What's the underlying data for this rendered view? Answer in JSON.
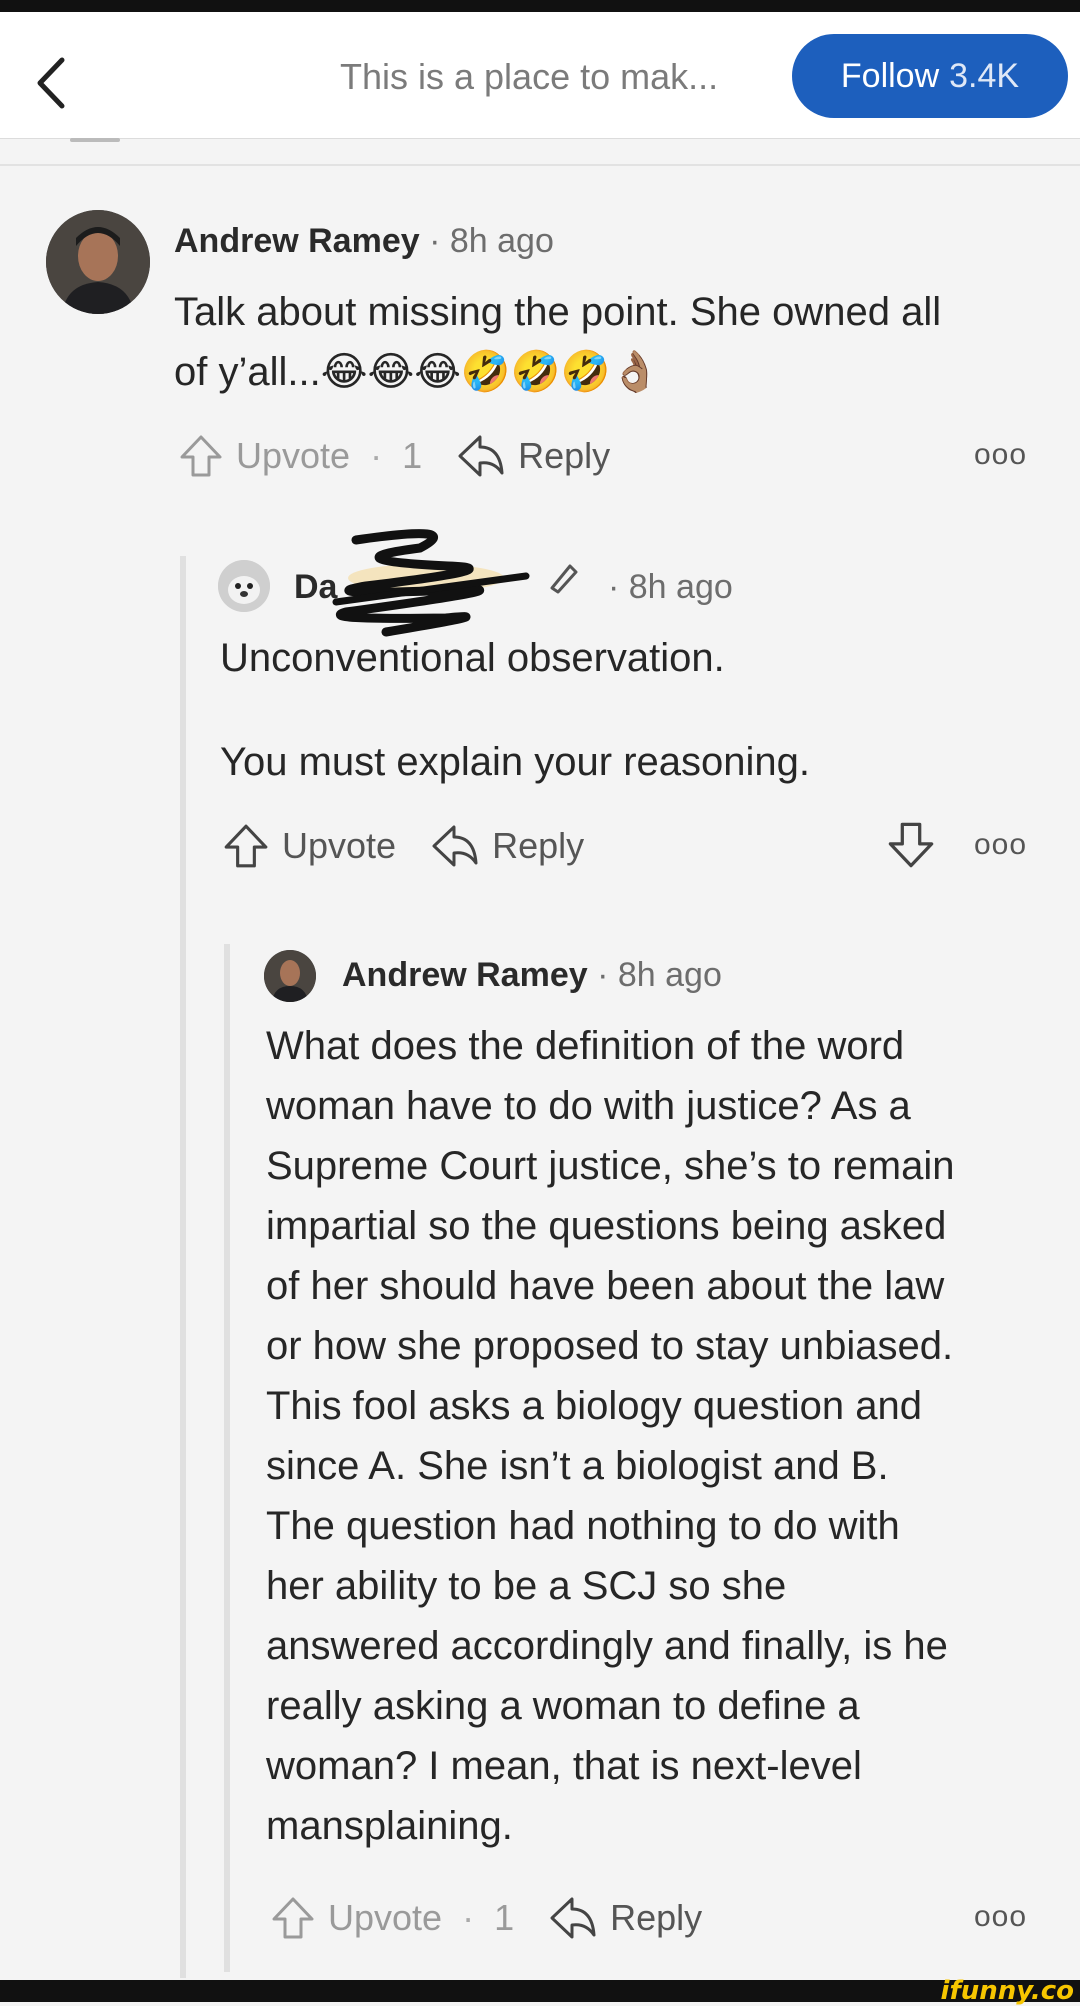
{
  "header": {
    "title": "This is a place to mak...",
    "follow_label": "Follow",
    "follow_count": "3.4K"
  },
  "comments": [
    {
      "author": "Andrew Ramey",
      "time": "· 8h ago",
      "text_line1": "Talk about missing the point. She owned all",
      "text_line2": "of y’all...",
      "emojis": "😂😂😂🤣🤣🤣👌🏽",
      "upvote_label": "Upvote",
      "upvote_count": "1",
      "reply_label": "Reply"
    },
    {
      "author": "Da",
      "time": "· 8h ago",
      "paragraph1": "Unconventional observation.",
      "paragraph2": "You must explain your reasoning.",
      "upvote_label": "Upvote",
      "reply_label": "Reply"
    },
    {
      "author": "Andrew Ramey",
      "time": "· 8h ago",
      "lines": [
        "What does the definition of the word",
        "woman have to do with justice? As a",
        "Supreme Court justice, she’s to remain",
        "impartial so the questions being asked",
        "of her should have been about the law",
        "or how she proposed to stay unbiased.",
        "This fool asks a biology question and",
        "since A. She isn’t a biologist and B.",
        "The question had nothing to do with",
        "her ability to be a SCJ so she",
        "answered accordingly and finally, is he",
        "really asking a woman to define a",
        "woman? I mean, that is next-level",
        "mansplaining."
      ],
      "upvote_label": "Upvote",
      "upvote_count": "1",
      "reply_label": "Reply"
    }
  ],
  "more_label": "ooo",
  "watermark": "ifunny.co"
}
